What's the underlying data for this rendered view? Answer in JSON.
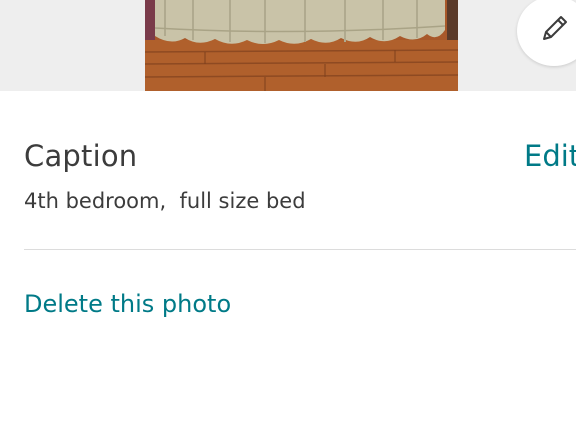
{
  "photo": {
    "alt_icon": "bedroom-photo",
    "edit_icon": "pencil-icon"
  },
  "caption": {
    "label": "Caption",
    "edit_label": "Edit",
    "value": "4th bedroom,  full size bed"
  },
  "actions": {
    "delete_label": "Delete this photo"
  },
  "colors": {
    "accent": "#007a87",
    "text": "#3c3c3c",
    "divider": "#dcdcdc",
    "photo_strip_bg": "#eeeeee"
  }
}
